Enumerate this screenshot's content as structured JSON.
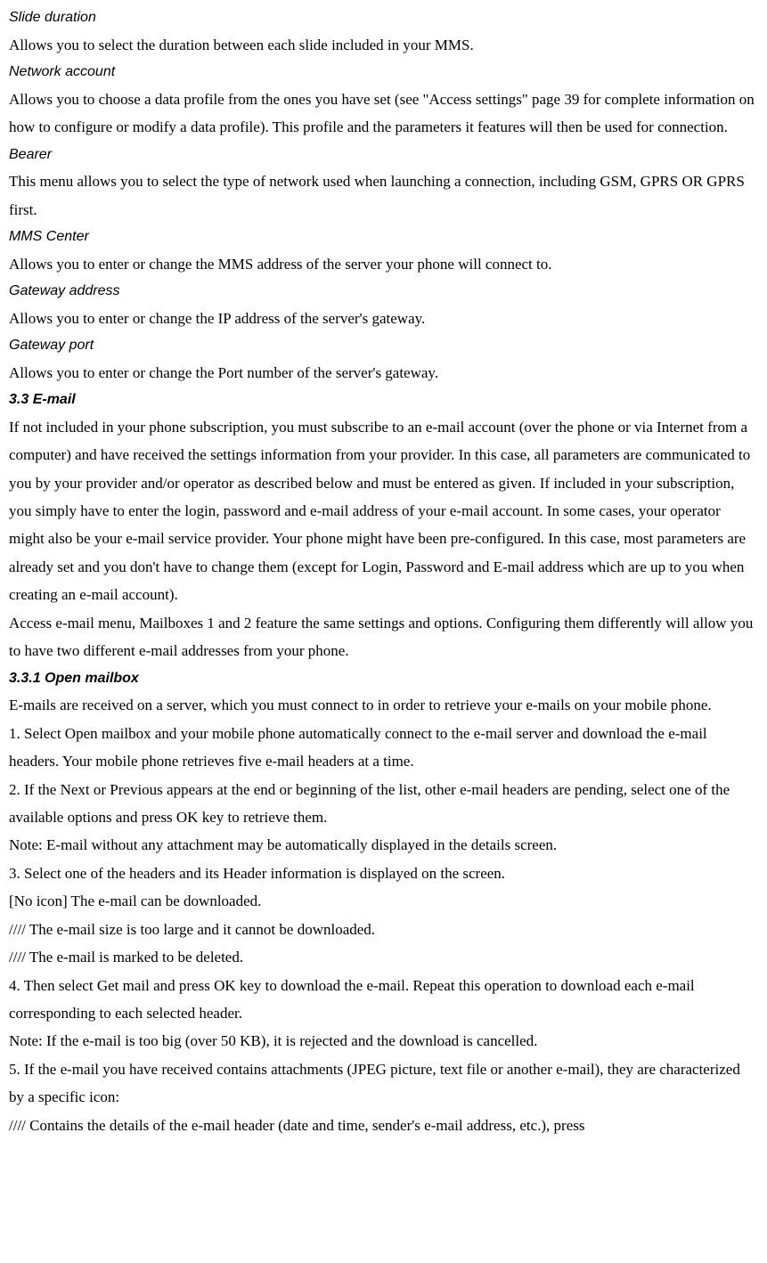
{
  "sections": {
    "slideDuration": {
      "heading": "Slide duration",
      "body": "Allows you to select the duration between each slide included in your MMS."
    },
    "networkAccount": {
      "heading": "Network account",
      "body": "Allows you to choose a data profile from the ones you have set (see \"Access settings\" page 39 for complete information on how to configure or modify a data profile). This profile and the parameters it features will then be used for connection."
    },
    "bearer": {
      "heading": "Bearer",
      "body": "This menu allows you to select the type of network used when launching a connection, including GSM, GPRS OR GPRS first."
    },
    "mmsCenter": {
      "heading": "MMS Center",
      "body": "Allows you to enter or change the MMS address of the server your phone will connect to."
    },
    "gatewayAddress": {
      "heading": "Gateway address",
      "body": "Allows you to enter or change the IP address of the server's gateway."
    },
    "gatewayPort": {
      "heading": "Gateway port",
      "body": "Allows you to enter or change the Port number of the server's gateway."
    },
    "email": {
      "heading": "3.3 E-mail",
      "body1": "If not included in your phone subscription, you must subscribe to an e-mail account (over the phone or via Internet from a computer) and have received the settings information from your provider. In this case, all parameters are communicated to you by your provider and/or operator as described below and must be entered as given. If included in your subscription, you simply have to enter the login, password and e-mail address of your e-mail account. In some cases, your operator might also be your e-mail service provider. Your phone might have been pre-configured. In this case, most parameters are already set and you don't have to change them (except for Login, Password and E-mail address which are up to you when creating an e-mail account).",
      "body2": "Access e-mail menu, Mailboxes 1 and 2 feature the same settings and options. Configuring them differently will allow you to have two different e-mail addresses from your phone."
    },
    "openMailbox": {
      "heading": "3.3.1 Open mailbox",
      "body1": "E-mails are received on a server, which you must connect to in order to retrieve your e-mails on your mobile phone.",
      "step1": "1. Select Open mailbox and your mobile phone automatically connect to the e-mail server and download the e-mail headers. Your mobile phone retrieves five e-mail headers at a time.",
      "step2": "2. If the Next or Previous appears at the end or beginning of the list, other e-mail headers are pending, select one of the available options and press OK key to retrieve them.",
      "note1": "Note: E-mail without any attachment may be automatically displayed in the details screen.",
      "step3": "3. Select one of the headers and its Header information is displayed on the screen.",
      "noIcon": "[No icon] The e-mail can be downloaded.",
      "icon1": "//// The e-mail size is too large and it cannot be downloaded.",
      "icon2": "//// The e-mail is marked to be deleted.",
      "step4": "4. Then select Get mail and press OK key to download the e-mail. Repeat this operation to download each e-mail corresponding to each selected header.",
      "note2": "Note: If the e-mail is too big (over 50 KB), it is rejected and the download is cancelled.",
      "step5": "5. If the e-mail you have received contains attachments (JPEG picture, text file or another e-mail), they are characterized by a specific icon:",
      "icon3": "//// Contains the details of the e-mail header (date and time, sender's e-mail address, etc.), press"
    }
  }
}
